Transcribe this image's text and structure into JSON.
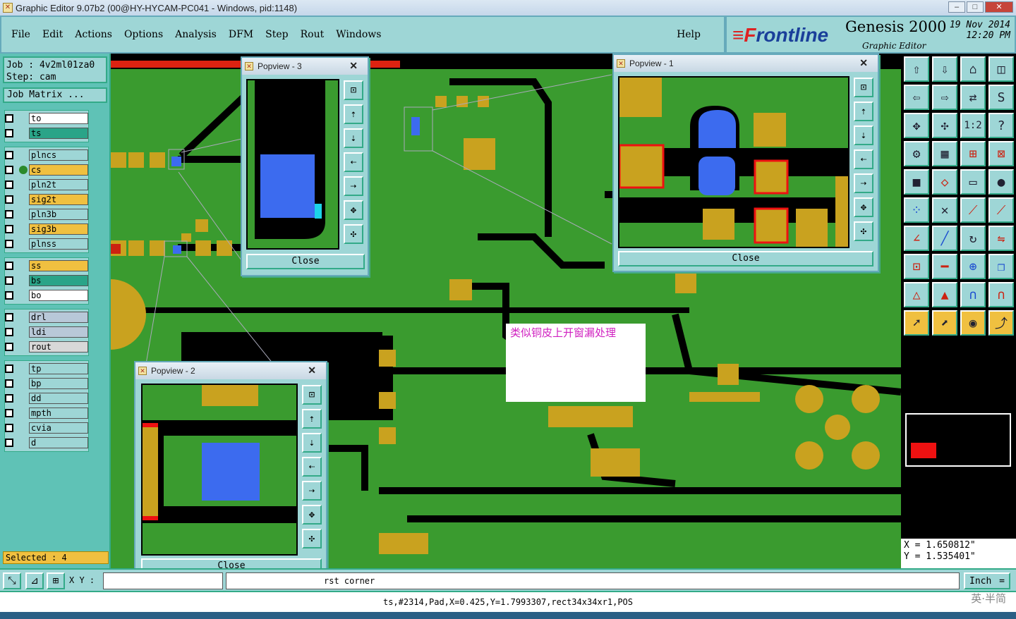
{
  "window": {
    "title": "Graphic Editor 9.07b2 (00@HY-HYCAM-PC041 - Windows, pid:1148)"
  },
  "menu": {
    "items": [
      "File",
      "Edit",
      "Actions",
      "Options",
      "Analysis",
      "DFM",
      "Step",
      "Rout",
      "Windows"
    ],
    "help": "Help"
  },
  "brand": {
    "logo_mark": "≡F",
    "logo_rest": "rontline",
    "product": "Genesis 2000",
    "subtitle": "Graphic Editor",
    "date": "19 Nov 2014",
    "time": "12:20 PM"
  },
  "job": {
    "job_label": "Job : 4v2ml01za0",
    "step_label": "Step: cam",
    "matrix_button": "Job Matrix ..."
  },
  "layers": {
    "group1": [
      {
        "name": "to",
        "color": "#ffffff"
      },
      {
        "name": "ts",
        "color": "#2aa488",
        "active": true
      }
    ],
    "group2": [
      {
        "name": "plncs",
        "color": "#9ed6d6"
      },
      {
        "name": "cs",
        "color": "#f0c040",
        "dot": true
      },
      {
        "name": "pln2t",
        "color": "#9ed6d6"
      },
      {
        "name": "sig2t",
        "color": "#f0c040"
      },
      {
        "name": "pln3b",
        "color": "#9ed6d6"
      },
      {
        "name": "sig3b",
        "color": "#f0c040"
      },
      {
        "name": "plnss",
        "color": "#9ed6d6"
      }
    ],
    "group3": [
      {
        "name": "ss",
        "color": "#f0c040"
      },
      {
        "name": "bs",
        "color": "#2aa488"
      },
      {
        "name": "bo",
        "color": "#ffffff"
      }
    ],
    "group4": [
      {
        "name": "drl",
        "color": "#b8c8d8"
      },
      {
        "name": "ldi",
        "color": "#b8c8d8"
      },
      {
        "name": "rout",
        "color": "#d8d8d8"
      }
    ],
    "group5": [
      {
        "name": "tp",
        "color": "#9ed6d6"
      },
      {
        "name": "bp",
        "color": "#9ed6d6"
      },
      {
        "name": "dd",
        "color": "#9ed6d6"
      },
      {
        "name": "mpth",
        "color": "#9ed6d6"
      },
      {
        "name": "cvia",
        "color": "#9ed6d6"
      },
      {
        "name": "d",
        "color": "#9ed6d6"
      }
    ]
  },
  "selected": "Selected : 4",
  "popups": {
    "p1": {
      "title": "Popview - 1",
      "close": "Close"
    },
    "p2": {
      "title": "Popview - 2",
      "close": "Close"
    },
    "p3": {
      "title": "Popview - 3",
      "close": "Close"
    }
  },
  "note": "类似铜皮上开窗漏处理",
  "coords": {
    "x": "X = 1.650812\"",
    "y": "Y = 1.535401\""
  },
  "bottom": {
    "xy_label": "X Y :",
    "prompt": "rst corner",
    "unit": "Inch",
    "unit_icon": "="
  },
  "status": "ts,#2314,Pad,X=0.425,Y=1.7993307,rect34x34xr1,POS",
  "watermark": "英·半简",
  "colors": {
    "board": "#3a9b2f",
    "pad": "#c9a21f",
    "select": "#3c6bef",
    "trace": "#000000",
    "panel": "#9ed6d6"
  }
}
